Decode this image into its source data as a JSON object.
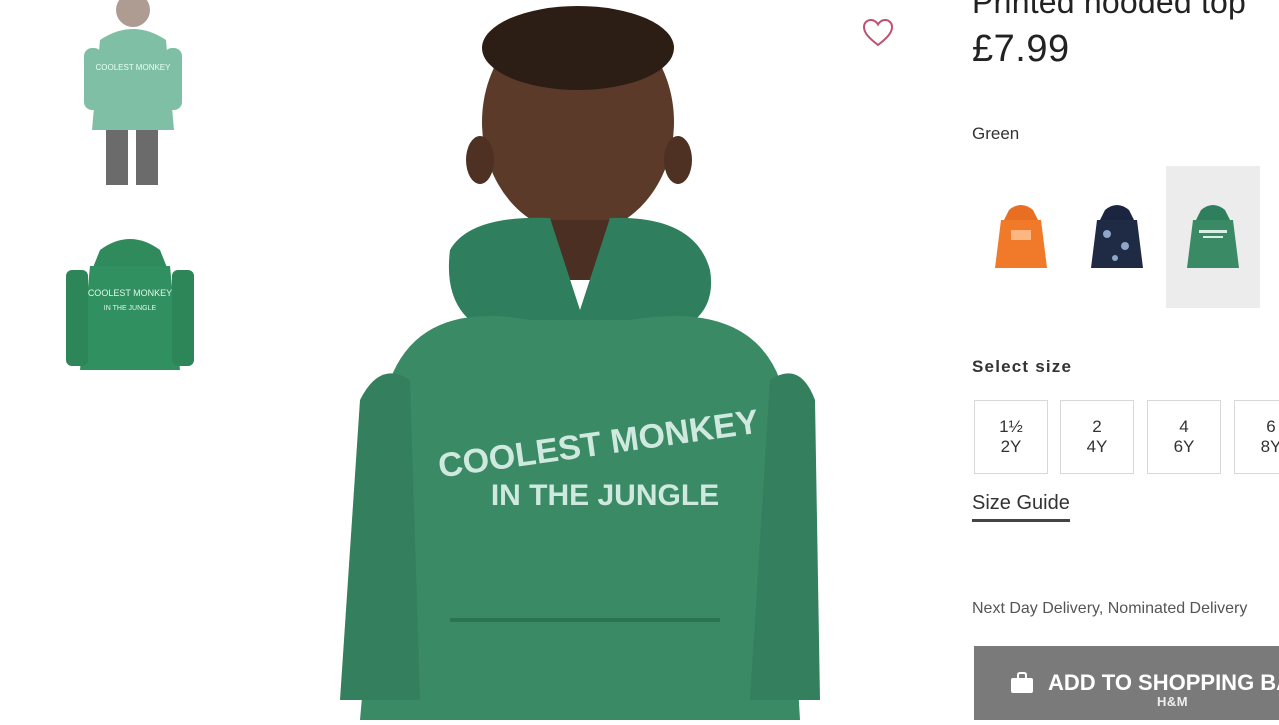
{
  "product": {
    "title": "Printed hooded top",
    "price": "£7.99",
    "color_name": "Green",
    "graphic_text_line1": "COOLEST MONKEY",
    "graphic_text_line2": "IN THE JUNGLE",
    "thumbnails": [
      {
        "name": "model-front"
      },
      {
        "name": "product-flat"
      }
    ],
    "swatches": [
      {
        "color": "#f07a2a",
        "selected": false
      },
      {
        "color": "#1f2a44",
        "selected": false
      },
      {
        "color": "#3f8f6a",
        "selected": true
      }
    ]
  },
  "size": {
    "label": "Select size",
    "options": [
      {
        "line1": "1½",
        "line2": "2Y"
      },
      {
        "line1": "2",
        "line2": "4Y"
      },
      {
        "line1": "4",
        "line2": "6Y"
      },
      {
        "line1": "6",
        "line2": "8Y"
      }
    ],
    "guide_label": "Size Guide"
  },
  "delivery_text": "Next Day Delivery, Nominated Delivery",
  "cta": {
    "label": "ADD TO SHOPPING BAG"
  },
  "watermark": "H&M",
  "colors": {
    "hoodie_green": "#3a8a66",
    "cta_gray": "#7a7a7a",
    "heart": "#c0506f"
  }
}
